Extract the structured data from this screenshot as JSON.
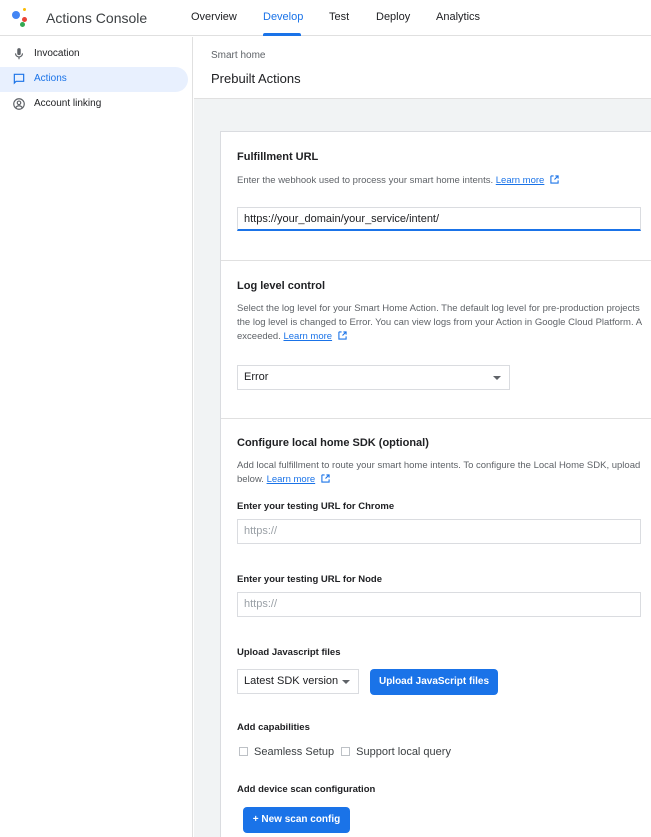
{
  "app": {
    "title": "Actions Console"
  },
  "nav": {
    "tabs": [
      {
        "label": "Overview"
      },
      {
        "label": "Develop"
      },
      {
        "label": "Test"
      },
      {
        "label": "Deploy"
      },
      {
        "label": "Analytics"
      }
    ],
    "active_tab": "Develop"
  },
  "sidebar": {
    "items": [
      {
        "label": "Invocation",
        "icon": "mic-icon"
      },
      {
        "label": "Actions",
        "icon": "chat-icon"
      },
      {
        "label": "Account linking",
        "icon": "account-circle-icon"
      }
    ],
    "active_item": "Actions"
  },
  "header": {
    "breadcrumb": "Smart home",
    "title": "Prebuilt Actions"
  },
  "fulfillment": {
    "title": "Fulfillment URL",
    "description": "Enter the webhook used to process your smart home intents.",
    "learn_more": "Learn more",
    "url_value": "https://your_domain/your_service/intent/"
  },
  "log_level": {
    "title": "Log level control",
    "description_lines": [
      "Select the log level for your Smart Home Action. The default log level for pre-production projects",
      "the log level is changed to Error. You can view logs from your Action in Google Cloud Platform. A",
      "exceeded."
    ],
    "learn_more": "Learn more",
    "selected": "Error"
  },
  "local_home": {
    "title": "Configure local home SDK (optional)",
    "description_lines": [
      "Add local fulfillment to route your smart home intents. To configure the Local Home SDK, upload",
      "below."
    ],
    "learn_more": "Learn more",
    "chrome_label": "Enter your testing URL for Chrome",
    "chrome_placeholder": "https://",
    "node_label": "Enter your testing URL for Node",
    "node_placeholder": "https://",
    "upload_label": "Upload Javascript files",
    "sdk_version": "Latest SDK version",
    "upload_button": "Upload JavaScript files",
    "capabilities_label": "Add capabilities",
    "capabilities": [
      {
        "label": "Seamless Setup",
        "checked": false
      },
      {
        "label": "Support local query",
        "checked": false
      }
    ],
    "scan_label": "Add device scan configuration",
    "scan_button": "+ New scan config"
  },
  "colors": {
    "accent": "#1a73e8",
    "active_bg": "#e8f0fe",
    "page_bg": "#f1f3f4"
  }
}
